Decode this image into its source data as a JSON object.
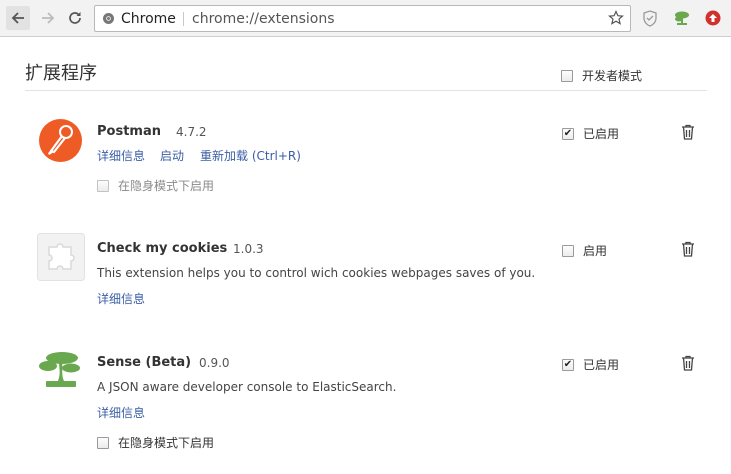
{
  "browser": {
    "site_label": "Chrome",
    "url": "chrome://extensions"
  },
  "page": {
    "title": "扩展程序",
    "developer_mode_label": "开发者模式",
    "developer_mode_checked": false
  },
  "extensions": [
    {
      "name": "Postman",
      "version": "4.7.2",
      "links": [
        "详细信息",
        "启动",
        "重新加载 (Ctrl+R)"
      ],
      "enabled_label": "已启用",
      "enabled": true,
      "incognito_label": "在隐身模式下启用",
      "incognito_enabled": false,
      "icon": "postman-logo-icon"
    },
    {
      "name": "Check my cookies",
      "version": "1.0.3",
      "description": "This extension helps you to control wich cookies webpages saves of you.",
      "links": [
        "详细信息"
      ],
      "enabled_label": "启用",
      "enabled": false,
      "icon": "puzzle-piece-icon"
    },
    {
      "name": "Sense (Beta)",
      "version": "0.9.0",
      "description": "A JSON aware developer console to ElasticSearch.",
      "links": [
        "详细信息"
      ],
      "enabled_label": "已启用",
      "enabled": true,
      "incognito_label": "在隐身模式下启用",
      "incognito_enabled": false,
      "icon": "bonsai-tree-icon"
    }
  ]
}
